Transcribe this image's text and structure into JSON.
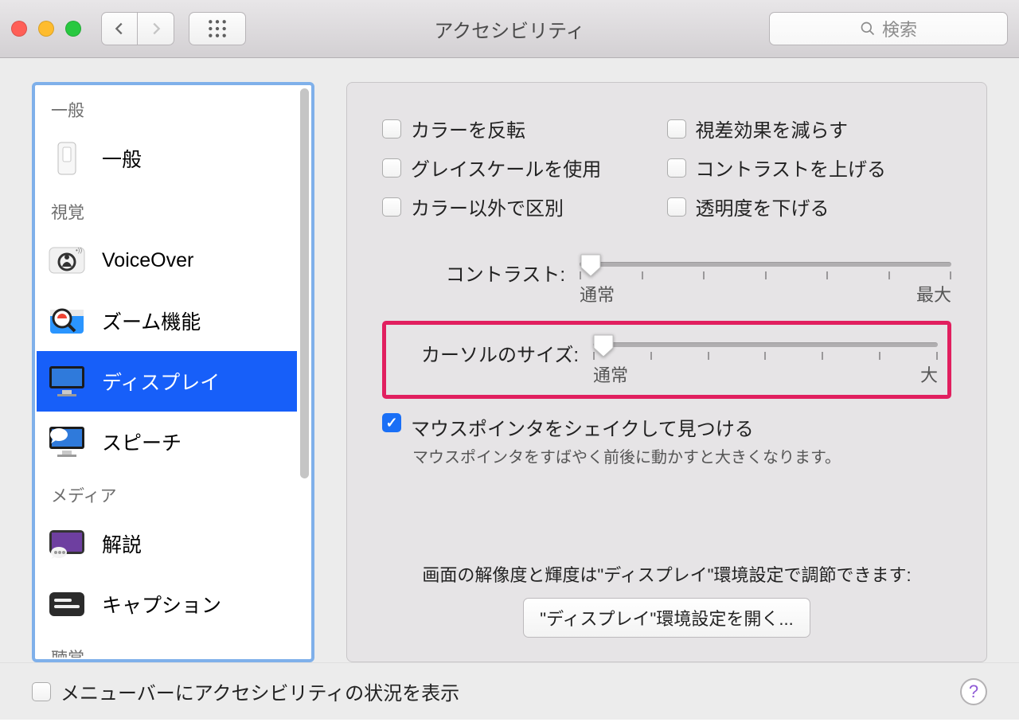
{
  "window": {
    "title": "アクセシビリティ",
    "search_placeholder": "検索"
  },
  "sidebar": {
    "sections": [
      {
        "header": "一般",
        "items": [
          {
            "id": "general",
            "label": "一般",
            "selected": false
          }
        ]
      },
      {
        "header": "視覚",
        "items": [
          {
            "id": "voiceover",
            "label": "VoiceOver",
            "selected": false
          },
          {
            "id": "zoom",
            "label": "ズーム機能",
            "selected": false
          },
          {
            "id": "display",
            "label": "ディスプレイ",
            "selected": true
          },
          {
            "id": "speech",
            "label": "スピーチ",
            "selected": false
          }
        ]
      },
      {
        "header": "メディア",
        "items": [
          {
            "id": "descriptions",
            "label": "解説",
            "selected": false
          },
          {
            "id": "captions",
            "label": "キャプション",
            "selected": false
          }
        ]
      },
      {
        "header": "聴覚",
        "items": []
      }
    ]
  },
  "panel": {
    "checks_left": [
      {
        "id": "invert",
        "label": "カラーを反転",
        "checked": false
      },
      {
        "id": "grayscale",
        "label": "グレイスケールを使用",
        "checked": false
      },
      {
        "id": "diffcolor",
        "label": "カラー以外で区別",
        "checked": false
      }
    ],
    "checks_right": [
      {
        "id": "reducemotion",
        "label": "視差効果を減らす",
        "checked": false
      },
      {
        "id": "contrastup",
        "label": "コントラストを上げる",
        "checked": false
      },
      {
        "id": "reducetrans",
        "label": "透明度を下げる",
        "checked": false
      }
    ],
    "contrast": {
      "label": "コントラスト:",
      "min_label": "通常",
      "max_label": "最大",
      "ticks": 7,
      "value_percent": 0
    },
    "cursor": {
      "label": "カーソルのサイズ:",
      "min_label": "通常",
      "max_label": "大",
      "ticks": 7,
      "value_percent": 0
    },
    "shake": {
      "checked": true,
      "title": "マウスポインタをシェイクして見つける",
      "subtitle": "マウスポインタをすばやく前後に動かすと大きくなります。"
    },
    "footer": {
      "msg": "画面の解像度と輝度は\"ディスプレイ\"環境設定で調節できます:",
      "button": "\"ディスプレイ\"環境設定を開く..."
    }
  },
  "bottom": {
    "menubar_status": "メニューバーにアクセシビリティの状況を表示"
  }
}
